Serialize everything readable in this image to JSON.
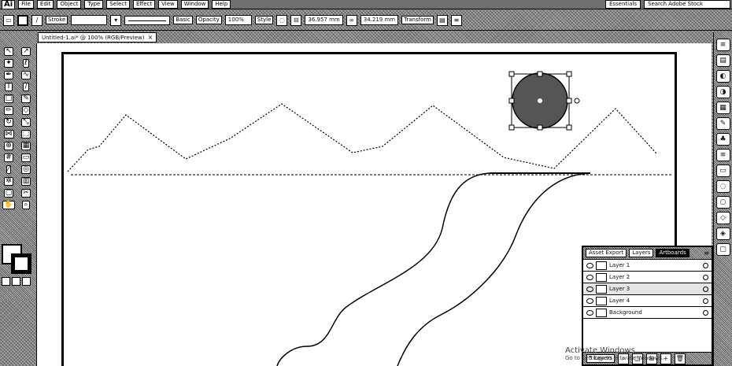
{
  "menubar": {
    "logo": "Ai",
    "items": [
      "File",
      "Edit",
      "Object",
      "Type",
      "Select",
      "Effect",
      "View",
      "Window",
      "Help"
    ],
    "workspace": "Essentials",
    "search_placeholder": "Search Adobe Stock"
  },
  "controlbar": {
    "stroke_label": "Stroke",
    "stroke_style": "Basic",
    "opacity_label": "Opacity",
    "opacity_value": "100%",
    "style_label": "Style",
    "width_value": "36.957 mm",
    "height_value": "34.219 mm",
    "transform_label": "Transform"
  },
  "document": {
    "tab_title": "Untitled-1.ai* @ 100% (RGB/Preview)",
    "close": "×"
  },
  "tools": {
    "items": [
      {
        "name": "selection-tool",
        "glyph": "↖"
      },
      {
        "name": "direct-selection-tool",
        "glyph": "↗"
      },
      {
        "name": "magic-wand-tool",
        "glyph": "✦"
      },
      {
        "name": "lasso-tool",
        "glyph": "ℓ"
      },
      {
        "name": "pen-tool",
        "glyph": "✒"
      },
      {
        "name": "curvature-tool",
        "glyph": "∿"
      },
      {
        "name": "type-tool",
        "glyph": "T"
      },
      {
        "name": "line-segment-tool",
        "glyph": "/"
      },
      {
        "name": "rectangle-tool",
        "glyph": "□"
      },
      {
        "name": "paintbrush-tool",
        "glyph": "✎"
      },
      {
        "name": "pencil-tool",
        "glyph": "✏"
      },
      {
        "name": "eraser-tool",
        "glyph": "◇"
      },
      {
        "name": "rotate-tool",
        "glyph": "↻"
      },
      {
        "name": "scale-tool",
        "glyph": "⤡"
      },
      {
        "name": "width-tool",
        "glyph": "⋈"
      },
      {
        "name": "free-transform-tool",
        "glyph": "⬚"
      },
      {
        "name": "shape-builder-tool",
        "glyph": "⊕"
      },
      {
        "name": "perspective-grid-tool",
        "glyph": "▦"
      },
      {
        "name": "mesh-tool",
        "glyph": "#"
      },
      {
        "name": "gradient-tool",
        "glyph": "▭"
      },
      {
        "name": "eyedropper-tool",
        "glyph": "⁄"
      },
      {
        "name": "blend-tool",
        "glyph": "◎"
      },
      {
        "name": "symbol-sprayer-tool",
        "glyph": "✲"
      },
      {
        "name": "column-graph-tool",
        "glyph": "▥"
      },
      {
        "name": "artboard-tool",
        "glyph": "▢"
      },
      {
        "name": "slice-tool",
        "glyph": "✂"
      },
      {
        "name": "hand-tool",
        "glyph": "✋"
      },
      {
        "name": "zoom-tool",
        "glyph": "⌕"
      }
    ]
  },
  "dock": {
    "icons": [
      "properties-icon",
      "libraries-icon",
      "color-icon",
      "color-guide-icon",
      "swatches-icon",
      "brushes-icon",
      "symbols-icon",
      "stroke-icon",
      "gradient-icon",
      "transparency-icon",
      "appearance-icon",
      "graphic-styles-icon",
      "layers-icon",
      "artboards-icon"
    ],
    "glyphs": [
      "≡",
      "▤",
      "◐",
      "◑",
      "▦",
      "✎",
      "♣",
      "≡",
      "▭",
      "◌",
      "○",
      "◇",
      "◈",
      "▢"
    ]
  },
  "layers_panel": {
    "tabs": [
      "Asset Export",
      "Layers",
      "Artboards"
    ],
    "active_tab": "Artboards",
    "rows": [
      {
        "name": "Layer 1",
        "selected": false
      },
      {
        "name": "Layer 2",
        "selected": false
      },
      {
        "name": "Layer 3",
        "selected": true
      },
      {
        "name": "Layer 4",
        "selected": false
      },
      {
        "name": "Background",
        "selected": false
      }
    ],
    "footer": "5 Layers"
  },
  "watermark": {
    "text": "Activate Windows",
    "sub": "Go to Settings to activate Windows."
  },
  "colors": {
    "ui_gray": "#8a8a8a",
    "canvas": "#ffffff",
    "ink": "#000000"
  }
}
